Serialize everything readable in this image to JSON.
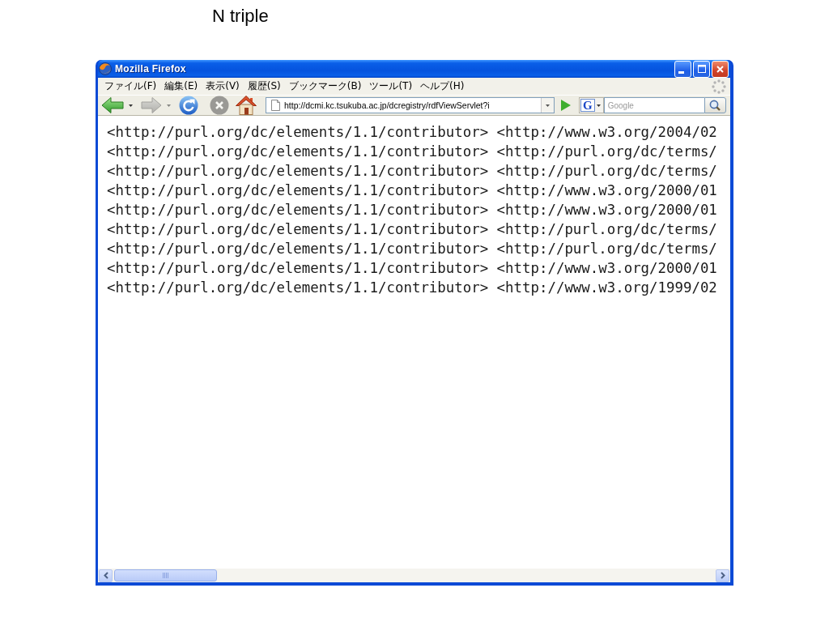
{
  "slide_title": "N triple",
  "window": {
    "title": "Mozilla Firefox"
  },
  "menu": [
    {
      "label": "ファイル(F)"
    },
    {
      "label": "編集(E)"
    },
    {
      "label": "表示(V)"
    },
    {
      "label": "履歴(S)"
    },
    {
      "label": "ブックマーク(B)"
    },
    {
      "label": "ツール(T)"
    },
    {
      "label": "ヘルプ(H)"
    }
  ],
  "toolbar": {
    "buttons": [
      {
        "kind": "back",
        "disabled": false
      },
      {
        "kind": "forward",
        "disabled": true
      },
      {
        "kind": "reload",
        "disabled": false
      },
      {
        "kind": "stop",
        "disabled": true
      },
      {
        "kind": "home",
        "disabled": false
      }
    ],
    "address": "http://dcmi.kc.tsukuba.ac.jp/dcregistry/rdfViewServlet?i",
    "search_engine": "G",
    "search": {
      "placeholder": "Google"
    }
  },
  "content": {
    "lines": [
      "<http://purl.org/dc/elements/1.1/contributor> <http://www.w3.org/2004/02",
      "<http://purl.org/dc/elements/1.1/contributor> <http://purl.org/dc/terms/",
      "<http://purl.org/dc/elements/1.1/contributor> <http://purl.org/dc/terms/",
      "<http://purl.org/dc/elements/1.1/contributor> <http://www.w3.org/2000/01",
      "<http://purl.org/dc/elements/1.1/contributor> <http://www.w3.org/2000/01",
      "<http://purl.org/dc/elements/1.1/contributor> <http://purl.org/dc/terms/",
      "<http://purl.org/dc/elements/1.1/contributor> <http://purl.org/dc/terms/",
      "<http://purl.org/dc/elements/1.1/contributor> <http://www.w3.org/2000/01",
      "<http://purl.org/dc/elements/1.1/contributor> <http://www.w3.org/1999/02"
    ]
  }
}
